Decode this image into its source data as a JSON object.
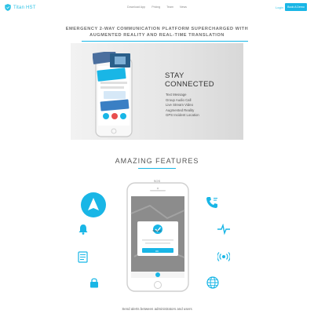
{
  "brand": {
    "name": "Titan HST",
    "accent": "#19b6e6"
  },
  "nav": {
    "links": [
      "Download App",
      "Pricing",
      "Team",
      "News"
    ],
    "login_label": "Login",
    "cta_label": "Book A Demo"
  },
  "hero": {
    "headline_line1": "EMERGENCY 2-WAY COMMUNICATION PLATFORM SUPERCHARGED WITH",
    "headline_line2": "AUGMENTED REALITY AND REAL-TIME TRANSLATION",
    "stay_line1": "STAY",
    "stay_line2": "CONNECTED",
    "features": [
      "Text Message",
      "Group Audio Call",
      "Live Stream Video",
      "Augmented Reality",
      "GPS Incident Location"
    ]
  },
  "features_section": {
    "title": "AMAZING FEATURES",
    "phone_header": "SOS",
    "modal_title": "Success",
    "modal_button": "OK",
    "caption": "Send alerts between administrators and users",
    "icons": [
      "alert-triangle-icon",
      "bell-icon",
      "document-icon",
      "lock-icon",
      "phone-icon",
      "heartbeat-icon",
      "broadcast-icon",
      "globe-icon"
    ]
  }
}
